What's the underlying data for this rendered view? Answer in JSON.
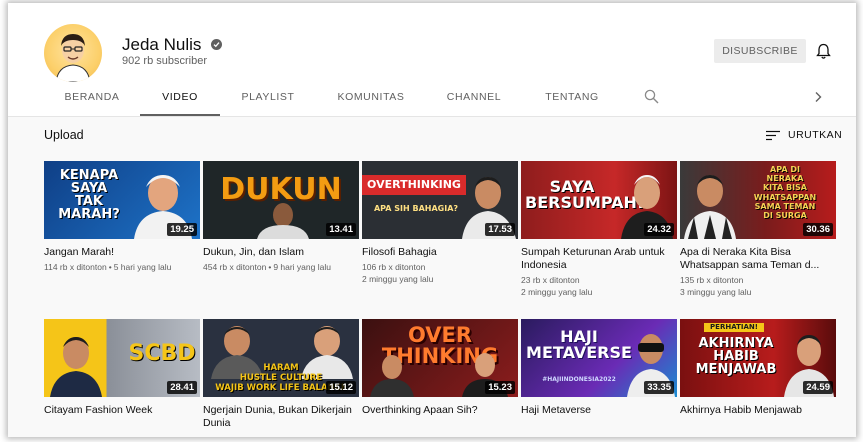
{
  "channel": {
    "name": "Jeda Nulis",
    "subscribers": "902 rb subscriber",
    "unsubscribe_label": "DISUBSCRIBE"
  },
  "tabs": [
    {
      "label": "BERANDA",
      "active": false
    },
    {
      "label": "VIDEO",
      "active": true
    },
    {
      "label": "PLAYLIST",
      "active": false
    },
    {
      "label": "KOMUNITAS",
      "active": false
    },
    {
      "label": "CHANNEL",
      "active": false
    },
    {
      "label": "TENTANG",
      "active": false
    }
  ],
  "section": {
    "title": "Upload",
    "sort_label": "URUTKAN"
  },
  "videos": [
    {
      "title": "Jangan Marah!",
      "views": "114 rb x ditonton",
      "age": "5 hari yang lalu",
      "duration": "19.25",
      "thumb_text": "KENAPA\nSAYA\nTAK\nMARAH?"
    },
    {
      "title": "Dukun, Jin, dan Islam",
      "views": "454 rb x ditonton",
      "age": "9 hari yang lalu",
      "duration": "13.41",
      "thumb_text": "DUKUN"
    },
    {
      "title": "Filosofi Bahagia",
      "views": "106 rb x ditonton",
      "age": "2 minggu yang lalu",
      "duration": "17.53",
      "thumb_text": "OVERTHINKING",
      "thumb_sub": "APA SIH BAHAGIA?"
    },
    {
      "title": "Sumpah Keturunan Arab untuk Indonesia",
      "views": "23 rb x ditonton",
      "age": "2 minggu yang lalu",
      "duration": "24.32",
      "thumb_text": "SAYA\nBERSUMPAH!"
    },
    {
      "title": "Apa di Neraka Kita Bisa Whatsappan sama Teman d...",
      "views": "135 rb x ditonton",
      "age": "3 minggu yang lalu",
      "duration": "30.36",
      "thumb_text": "APA DI\nNERAKA\nKITA BISA\nWHATSAPPAN\nSAMA TEMAN\nDI SURGA"
    },
    {
      "title": "Citayam Fashion Week",
      "views": "",
      "age": "",
      "duration": "28.41",
      "thumb_text": "SCBD"
    },
    {
      "title": "Ngerjain Dunia, Bukan Dikerjain Dunia",
      "views": "",
      "age": "",
      "duration": "15.12",
      "thumb_text": "HARAM\nHUSTLE CULTURE\nWAJIB WORK LIFE BALANCE"
    },
    {
      "title": "Overthinking Apaan Sih?",
      "views": "",
      "age": "",
      "duration": "15.23",
      "thumb_text": "OVER\nTHINKING"
    },
    {
      "title": "Haji Metaverse",
      "views": "",
      "age": "",
      "duration": "33.35",
      "thumb_text": "HAJI\nMETAVERSE",
      "thumb_sub": "#HAJIINDONESIA2022"
    },
    {
      "title": "Akhirnya Habib Menjawab",
      "views": "",
      "age": "",
      "duration": "24.59",
      "thumb_text": "AKHIRNYA\nHABIB\nMENJAWAB",
      "thumb_sub": "PERHATIAN!"
    }
  ],
  "colors": {
    "accent_red": "#e53935",
    "thumb_navy": "#1b3a6b",
    "thumb_orange": "#f39c12"
  }
}
